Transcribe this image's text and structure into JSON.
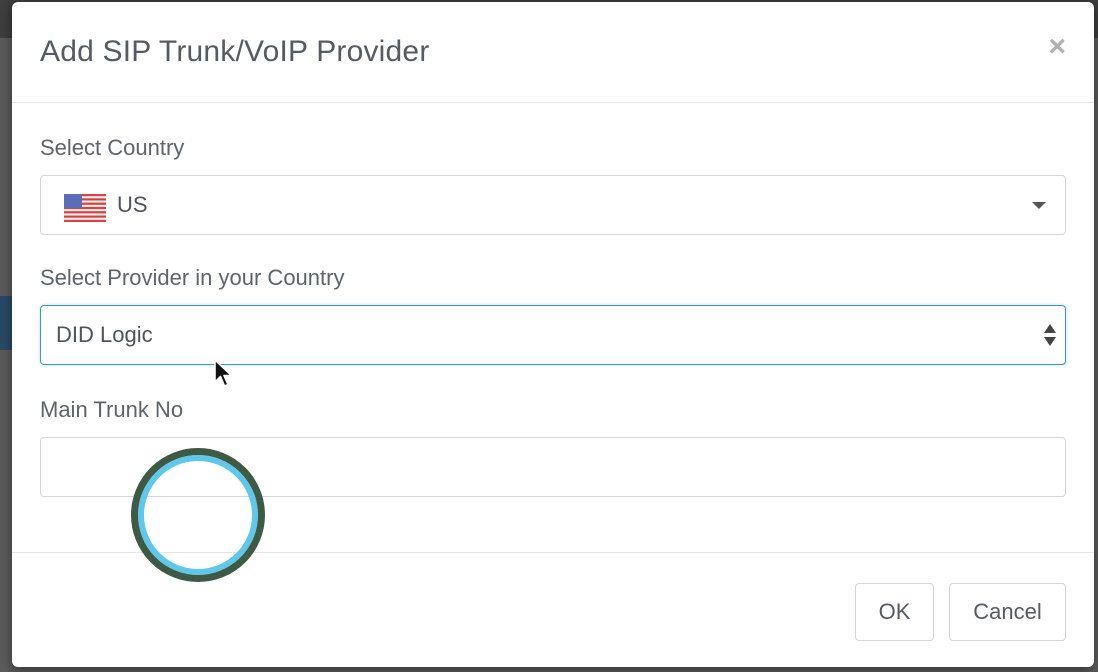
{
  "dialog": {
    "title": "Add SIP Trunk/VoIP Provider",
    "close_label": "×"
  },
  "country": {
    "label": "Select Country",
    "selected": "US",
    "flag_icon": "us-flag-icon"
  },
  "provider": {
    "label": "Select Provider in your Country",
    "selected": "DID Logic"
  },
  "trunk": {
    "label": "Main Trunk No",
    "value": "",
    "placeholder": ""
  },
  "footer": {
    "ok_label": "OK",
    "cancel_label": "Cancel"
  },
  "colors": {
    "focus_border": "#3e98c4",
    "click_ring_outer": "#3f5a44",
    "click_ring_inner": "#5fc8ea"
  }
}
